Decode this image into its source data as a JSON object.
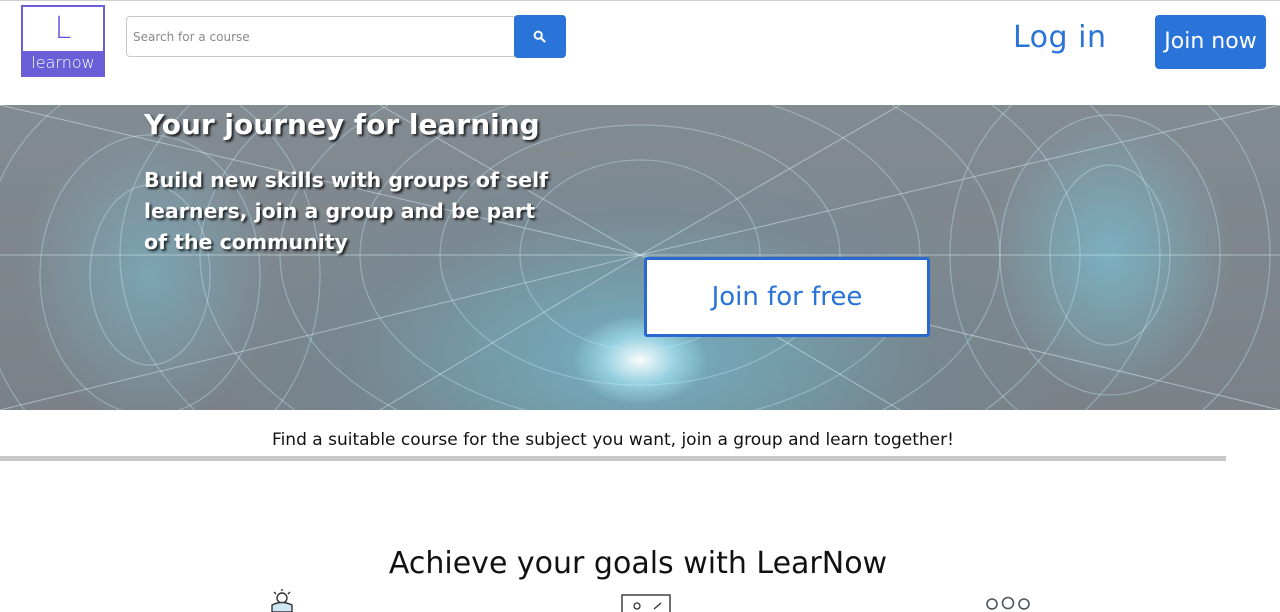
{
  "header": {
    "logo": {
      "letter": "L",
      "text": "learnow"
    },
    "search": {
      "placeholder": "Search for a course",
      "value": "",
      "button_icon": "search-icon"
    },
    "login_label": "Log in",
    "join_label": "Join now"
  },
  "hero": {
    "title": "Your journey for learning",
    "subtitle": "Build new skills with groups of self learners, join a group and be part of the community",
    "cta_label": "Join for free"
  },
  "tagline": "Find a suitable course for the subject you want, join a group and learn together!",
  "goals": {
    "title": "Achieve your goals with LearNow",
    "icons": [
      "idea-bulb-icon",
      "certificate-icon",
      "group-icon"
    ]
  },
  "colors": {
    "brand_blue": "#2a73d9",
    "logo_purple": "#6a5fd8"
  }
}
